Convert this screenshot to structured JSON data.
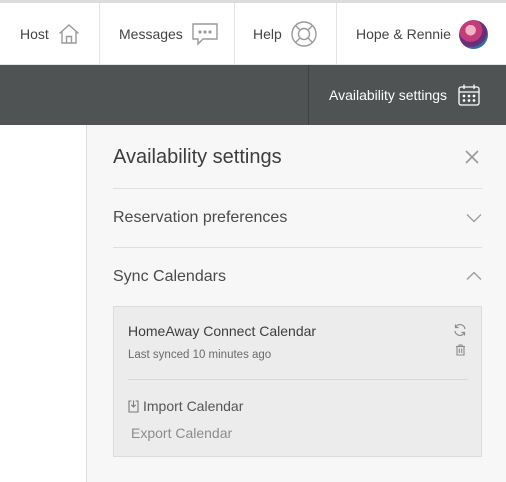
{
  "nav": {
    "host_label": "Host",
    "messages_label": "Messages",
    "help_label": "Help",
    "user_label": "Hope & Rennie"
  },
  "toolbar": {
    "availability_label": "Availability settings"
  },
  "panel": {
    "title": "Availability settings",
    "reservation_label": "Reservation preferences",
    "sync_label": "Sync Calendars",
    "calendar": {
      "name": "HomeAway Connect Calendar",
      "last_synced": "Last synced 10 minutes ago"
    },
    "import_label": "Import Calendar",
    "export_label": "Export Calendar"
  },
  "icons": {
    "host": "house-icon",
    "messages": "chat-bubble-icon",
    "help": "lifebuoy-icon",
    "calendar": "calendar-icon",
    "close": "close-icon",
    "refresh": "refresh-icon",
    "trash": "trash-icon",
    "import": "import-icon"
  },
  "colors": {
    "dark_bar": "#4f5353",
    "panel_bg": "#f7f7f7",
    "card_bg": "#ececec"
  }
}
